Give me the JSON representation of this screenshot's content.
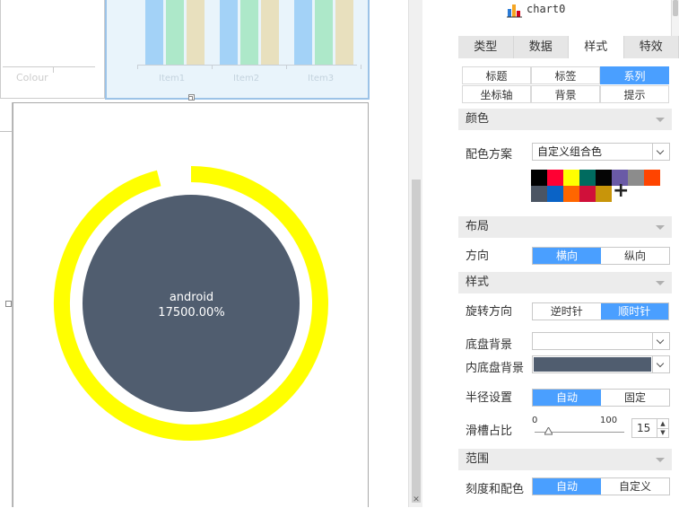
{
  "canvas": {
    "left_widget_label": "Colour",
    "bar_labels": [
      "Item1",
      "Item2",
      "Item3"
    ],
    "gauge": {
      "series_name": "android",
      "value_text": "17500.00%",
      "outer_ring_color": "#ffff00",
      "inner_disc_color": "#505d6f",
      "progress_fraction": 0.96
    }
  },
  "panel": {
    "chart_name": "chart0",
    "tabs": [
      "类型",
      "数据",
      "样式",
      "特效"
    ],
    "active_tab": "样式",
    "subtabs": [
      "标题",
      "标签",
      "系列",
      "坐标轴",
      "背景",
      "提示"
    ],
    "active_subtab": "系列",
    "sections": {
      "color": "颜色",
      "layout": "布局",
      "style": "样式",
      "range": "范围"
    },
    "color_scheme": {
      "label": "配色方案",
      "value": "自定义组合色",
      "swatches_row1": [
        "#000000",
        "#ff0033",
        "#ffff00",
        "#006b5f",
        "#050505",
        "#6a5aa6",
        "#8c8c8c",
        "#ff4400"
      ],
      "swatches_row2": [
        "#4b5563",
        "#0a63c6",
        "#ff6600",
        "#d0103a",
        "#c8950a"
      ],
      "add_icon": "+"
    },
    "direction": {
      "label": "方向",
      "options": [
        "横向",
        "纵向"
      ],
      "selected": "横向"
    },
    "rotation": {
      "label": "旋转方向",
      "options": [
        "逆时针",
        "顺时针"
      ],
      "selected": "顺时针"
    },
    "base_bg": {
      "label": "底盘背景",
      "value": ""
    },
    "inner_base_bg": {
      "label": "内底盘背景",
      "color": "#505d6f"
    },
    "radius": {
      "label": "半径设置",
      "options": [
        "自动",
        "固定"
      ],
      "selected": "自动"
    },
    "groove_ratio": {
      "label": "滑槽占比",
      "min": "0",
      "max": "100",
      "value": "15"
    },
    "ticks_colors": {
      "label": "刻度和配色",
      "options": [
        "自动",
        "自定义"
      ],
      "selected": "自动"
    }
  }
}
